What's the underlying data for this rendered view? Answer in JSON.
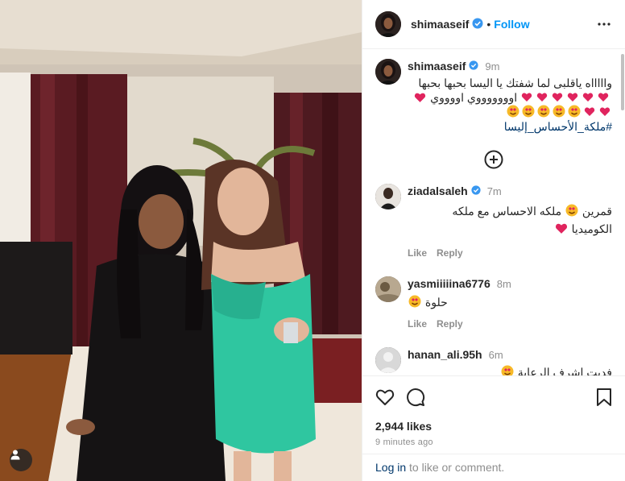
{
  "post": {
    "username": "shimaaseif",
    "follow_label": "Follow",
    "dot": "•"
  },
  "caption": {
    "username": "shimaaseif",
    "time": "9m",
    "line1": "واااااه ياقلبى لما شفتك يا اليسا بحبها بحبها",
    "line2": "اوووووووي اووووي",
    "hashtag": "#ملكة_الأحساس_إليسا"
  },
  "comments": [
    {
      "username": "ziadalsaleh",
      "verified": true,
      "time": "7m",
      "text_a": "قمرين",
      "text_b": "ملكه الاحساس مع ملكه",
      "text_c": "الكوميديا",
      "like": "Like",
      "reply": "Reply"
    },
    {
      "username": "yasmiiiiina6776",
      "verified": false,
      "time": "8m",
      "text_a": "حلوة",
      "like": "Like",
      "reply": "Reply"
    },
    {
      "username": "hanan_ali.95h",
      "verified": false,
      "time": "6m",
      "text_a": "فديت اشرف الرعاية"
    }
  ],
  "stats": {
    "likes": "2,944 likes",
    "ago": "9 minutes ago"
  },
  "login": {
    "link": "Log in",
    "rest": " to like or comment."
  },
  "icons": {
    "more": "more-options-icon",
    "like": "heart-icon",
    "comment": "comment-icon",
    "save": "bookmark-icon",
    "verified": "verified-badge-icon",
    "expand": "plus-circle-icon",
    "tags": "user-tag-icon"
  },
  "colors": {
    "accent": "#0095f6",
    "verified": "#3897f0",
    "heart": "#e0245e",
    "hashtag": "#00376b"
  }
}
